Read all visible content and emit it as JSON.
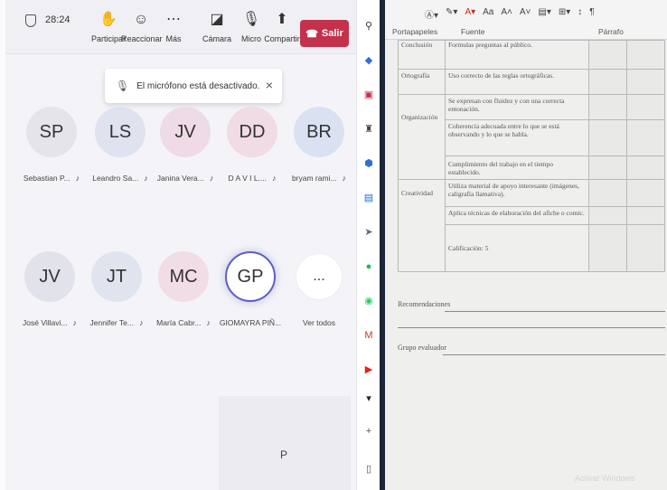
{
  "meeting": {
    "time": "28:24",
    "toolbar": {
      "participar": "Participar",
      "reaccionar": "Reaccionar",
      "mas": "Más",
      "camara": "Cámara",
      "micro": "Micro",
      "compartir": "Compartir",
      "salir": "Salir"
    },
    "toast": {
      "text": "El micrófono está desactivado."
    },
    "participants": [
      {
        "initials": "SP",
        "name": "Sebastian P...",
        "color": "#e4e4ea"
      },
      {
        "initials": "LS",
        "name": "Leandro Sa...",
        "color": "#dfe3f0"
      },
      {
        "initials": "JV",
        "name": "Janina Vera...",
        "color": "#eedbe6"
      },
      {
        "initials": "DD",
        "name": "D A V I L....",
        "color": "#f1dbe4"
      },
      {
        "initials": "BR",
        "name": "bryam rami...",
        "color": "#dae2f1"
      },
      {
        "initials": "JV",
        "name": "José Villavi...",
        "color": "#e2e2ea"
      },
      {
        "initials": "JT",
        "name": "Jennifer Te...",
        "color": "#e0e4ee"
      },
      {
        "initials": "MC",
        "name": "María Cabr...",
        "color": "#f1dde5"
      },
      {
        "initials": "GP",
        "name": "GIOMAYRA PIÑ...",
        "color": "#ffffff"
      }
    ],
    "more": {
      "label": "...",
      "caption": "Ver todos"
    },
    "self_initial": "P"
  },
  "word": {
    "ribbon": {
      "portapapeles": "Portapapeles",
      "fuente": "Fuente",
      "parrafo": "Párrafo",
      "font_size_label": "Aa"
    },
    "rubric": {
      "row0": {
        "criterion": "Conclusión",
        "desc": "Formulas preguntas al público."
      },
      "row1": {
        "criterion": "Ortografía",
        "desc": "Uso correcto de las reglas ortográficas."
      },
      "row2": {
        "criterion": "Organización",
        "desc_a": "Se expresan con fluidez y con una correcta entonación.",
        "desc_b": "Coherencia adecuada entre lo que se está observando y lo que se habla.",
        "desc_c": "Cumplimiento del trabajo en el tiempo establecido."
      },
      "row3": {
        "criterion": "Creatividad",
        "desc_a": "Utiliza material de apoyo interesante (imágenes, caligrafía llamativa).",
        "desc_b": "Aplica técnicas de elaboración del afiche o comic."
      },
      "calificacion": "Calificación: 5"
    },
    "recomendaciones": "Recomendaciones",
    "grupo": "Grupo evaluador",
    "watermark": "Activar Windows"
  }
}
